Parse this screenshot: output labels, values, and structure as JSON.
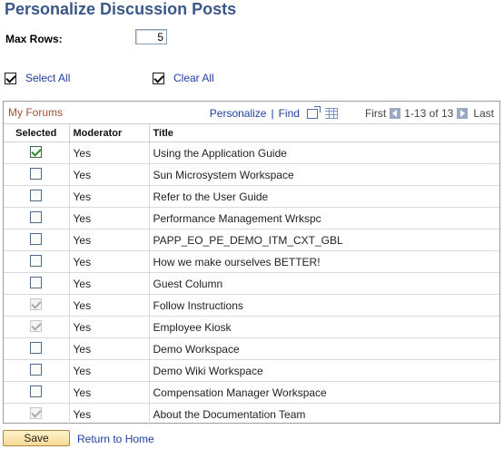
{
  "page": {
    "title": "Personalize Discussion Posts"
  },
  "max_rows": {
    "label": "Max Rows:",
    "value": "5"
  },
  "select_all": {
    "label": "Select All",
    "checked": true
  },
  "clear_all": {
    "label": "Clear All",
    "checked": true
  },
  "grid": {
    "title": "My Forums",
    "personalize_label": "Personalize",
    "find_label": "Find",
    "separator": "|",
    "first_label": "First",
    "range_label": "1-13 of 13",
    "last_label": "Last",
    "columns": {
      "selected": "Selected",
      "moderator": "Moderator",
      "title": "Title"
    },
    "rows": [
      {
        "state": "checked-green",
        "moderator": "Yes",
        "title": "Using the Application Guide"
      },
      {
        "state": "unchecked",
        "moderator": "Yes",
        "title": "Sun Microsystem Workspace"
      },
      {
        "state": "unchecked",
        "moderator": "Yes",
        "title": "Refer to the User Guide"
      },
      {
        "state": "unchecked",
        "moderator": "Yes",
        "title": "Performance Management Wrkspc"
      },
      {
        "state": "unchecked",
        "moderator": "Yes",
        "title": "PAPP_EO_PE_DEMO_ITM_CXT_GBL"
      },
      {
        "state": "unchecked",
        "moderator": "Yes",
        "title": "How we make ourselves BETTER!"
      },
      {
        "state": "unchecked",
        "moderator": "Yes",
        "title": "Guest Column"
      },
      {
        "state": "checked-disabled",
        "moderator": "Yes",
        "title": "Follow Instructions"
      },
      {
        "state": "checked-disabled",
        "moderator": "Yes",
        "title": "Employee Kiosk"
      },
      {
        "state": "unchecked",
        "moderator": "Yes",
        "title": "Demo Workspace"
      },
      {
        "state": "unchecked",
        "moderator": "Yes",
        "title": "Demo Wiki Workspace"
      },
      {
        "state": "unchecked",
        "moderator": "Yes",
        "title": "Compensation Manager Workspace"
      },
      {
        "state": "checked-disabled",
        "moderator": "Yes",
        "title": "About the Documentation Team"
      }
    ]
  },
  "footer": {
    "save_label": "Save",
    "return_label": "Return to Home"
  },
  "colors": {
    "title": "#3b5788",
    "link": "#1f3f9e",
    "grid_title": "#a0522d",
    "save_button": "#f7d995"
  },
  "icons": {
    "zoom": "view-all-icon",
    "download": "download-grid-icon",
    "prev": "previous-arrow-icon",
    "next": "next-arrow-icon"
  }
}
